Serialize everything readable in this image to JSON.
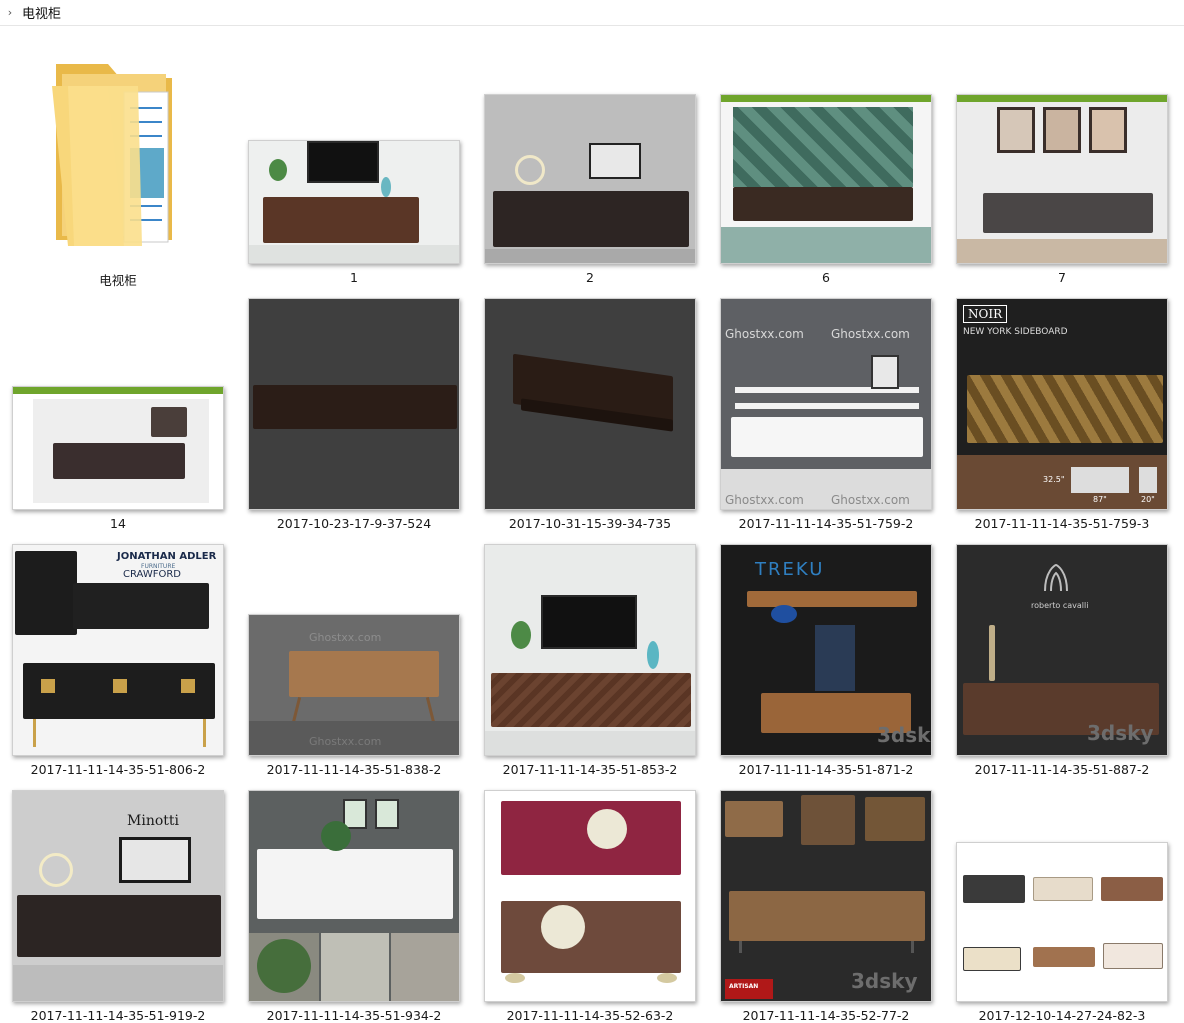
{
  "breadcrumb": {
    "chevron": "›",
    "path": "电视柜"
  },
  "items": [
    {
      "name": "电视柜",
      "type": "folder"
    },
    {
      "name": "1"
    },
    {
      "name": "2"
    },
    {
      "name": "6"
    },
    {
      "name": "7"
    },
    {
      "name": "14"
    },
    {
      "name": "2017-10-23-17-9-37-524"
    },
    {
      "name": "2017-10-31-15-39-34-735"
    },
    {
      "name": "2017-11-11-14-35-51-759-2"
    },
    {
      "name": "2017-11-11-14-35-51-759-3"
    },
    {
      "name": "2017-11-11-14-35-51-806-2"
    },
    {
      "name": "2017-11-11-14-35-51-838-2"
    },
    {
      "name": "2017-11-11-14-35-51-853-2"
    },
    {
      "name": "2017-11-11-14-35-51-871-2"
    },
    {
      "name": "2017-11-11-14-35-51-887-2"
    },
    {
      "name": "2017-11-11-14-35-51-919-2"
    },
    {
      "name": "2017-11-11-14-35-51-934-2"
    },
    {
      "name": "2017-11-11-14-35-52-63-2"
    },
    {
      "name": "2017-11-11-14-35-52-77-2"
    },
    {
      "name": "2017-12-10-14-27-24-82-3"
    }
  ],
  "thumb_text": {
    "ghost": "Ghostxx.com",
    "noir_logo": "NOIR",
    "noir_title": "NEW YORK SIDEBOARD",
    "noir_dim1": "32.5\"",
    "noir_dim2": "87\"",
    "noir_dim3": "20\"",
    "ja_brand": "JONATHAN ADLER",
    "ja_sub": "FURNITURE",
    "ja_model": "CRAWFORD",
    "treku": "TREKU",
    "sky": "3dsky",
    "cavalli": "roberto cavalli",
    "minotti": "Minotti",
    "artisan": "ARTISAN"
  }
}
